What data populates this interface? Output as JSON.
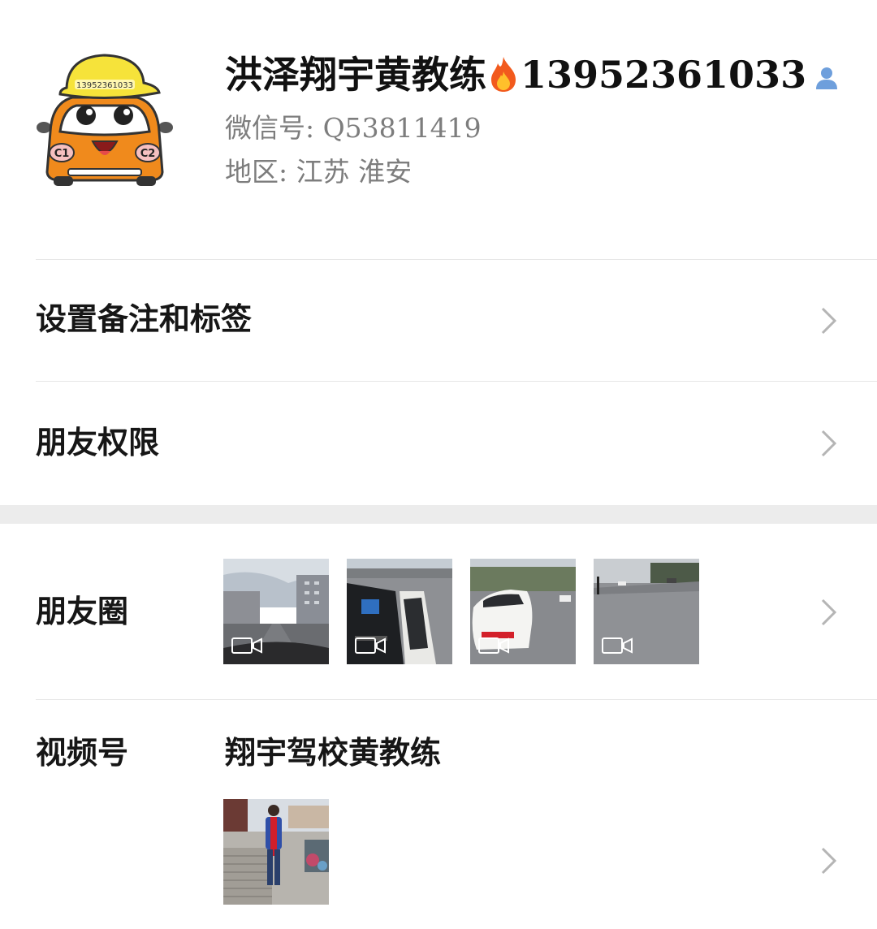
{
  "profile": {
    "nickname_prefix": "洪泽翔宇黄教练",
    "nickname_phone": "13952361033",
    "wechat_id": "微信号: Q53811419",
    "region": "地区: 江苏 淮安",
    "avatar_hat_text": "13952361033",
    "avatar_left_badge": "C1",
    "avatar_right_badge": "C2"
  },
  "rows": {
    "remark_label": "设置备注和标签",
    "permission_label": "朋友权限",
    "moments_label": "朋友圈",
    "channels_label": "视频号",
    "channels_name": "翔宇驾校黄教练"
  },
  "moments": {
    "thumbnails": [
      "road-view-video",
      "car-door-video",
      "white-car-video",
      "street-video"
    ]
  },
  "colors": {
    "text_primary": "#111111",
    "text_secondary": "#7d7d7d",
    "divider": "#e6e6e6",
    "band": "#ececec",
    "chevron": "#b5b5b5"
  }
}
